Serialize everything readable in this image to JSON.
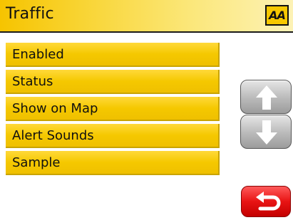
{
  "header": {
    "title": "Traffic",
    "logo_text": "AA"
  },
  "menu": {
    "items": [
      {
        "label": "Enabled"
      },
      {
        "label": "Status"
      },
      {
        "label": "Show on Map"
      },
      {
        "label": "Alert Sounds"
      },
      {
        "label": "Sample"
      }
    ]
  },
  "controls": {
    "scroll_up_icon": "arrow-up-icon",
    "scroll_down_icon": "arrow-down-icon",
    "back_icon": "return-arrow-icon"
  },
  "colors": {
    "accent_yellow": "#f5c800",
    "back_red": "#e81414",
    "scroll_gray": "#bdbdbd"
  }
}
